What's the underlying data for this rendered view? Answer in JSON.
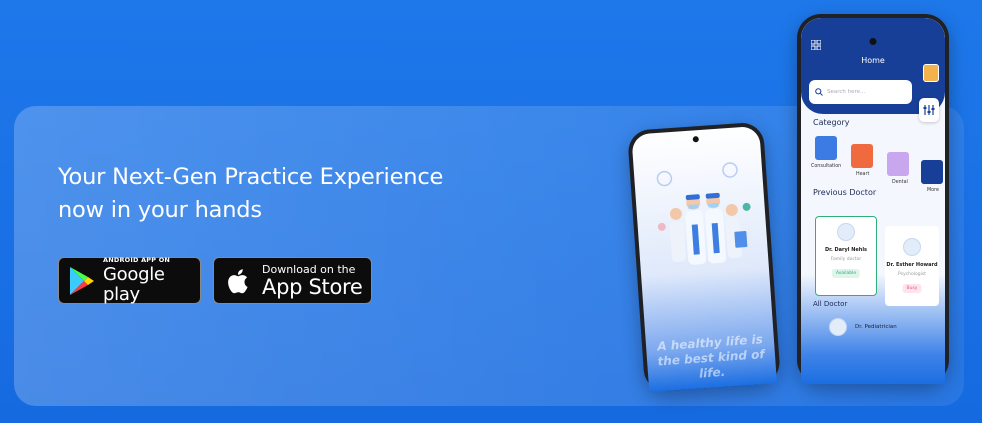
{
  "headline": {
    "line1": "Your Next-Gen Practice Experience",
    "line2": "now in your hands"
  },
  "google_play": {
    "small_label": "ANDROID APP ON",
    "big_label": "Google play"
  },
  "app_store": {
    "small_label": "Download on the",
    "big_label": "App Store"
  },
  "phone_left": {
    "tagline": "A healthy life is the best kind of life."
  },
  "phone_right": {
    "title": "Home",
    "search_placeholder": "Search here...",
    "category_title": "Category",
    "categories": [
      "Consultation",
      "Heart",
      "Dental",
      "More"
    ],
    "previous_doctor_title": "Previous Doctor",
    "doctors": [
      {
        "name": "Dr. Daryl Nehls",
        "specialty": "Family doctor",
        "badge": "Available"
      },
      {
        "name": "Dr. Esther Howard",
        "specialty": "Psychologist",
        "badge": "Busy"
      }
    ],
    "all_doctor_title": "All Doctor",
    "all_doctor_first": "Dr. Pediatrician"
  },
  "colors": {
    "background": "#1a6fe0",
    "accent_dark": "#173f97",
    "available_green": "#2fb07b",
    "busy_pink": "#e35a8a"
  }
}
